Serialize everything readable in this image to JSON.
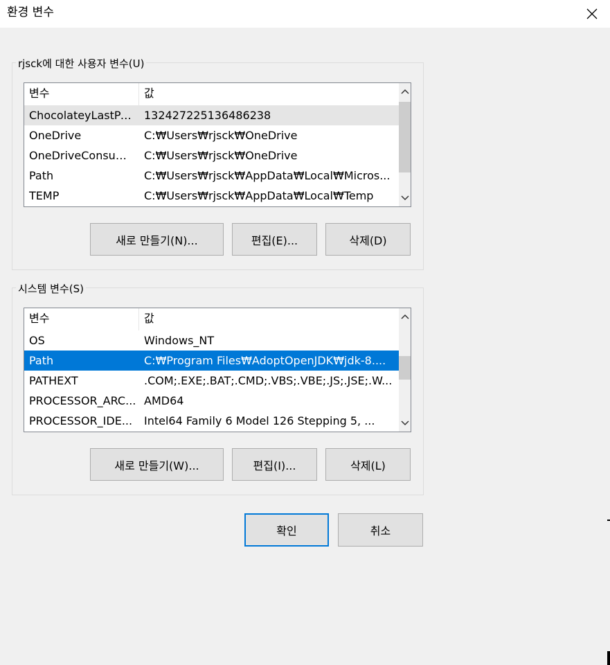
{
  "window": {
    "title": "환경 변수",
    "close_icon": "close-icon"
  },
  "user_vars": {
    "group_label": "rjsck에 대한 사용자 변수(U)",
    "columns": [
      "변수",
      "값"
    ],
    "rows": [
      {
        "name": "ChocolateyLastPa...",
        "value": "132427225136486238"
      },
      {
        "name": "OneDrive",
        "value": "C:₩Users₩rjsck₩OneDrive"
      },
      {
        "name": "OneDriveConsumer",
        "value": "C:₩Users₩rjsck₩OneDrive"
      },
      {
        "name": "Path",
        "value": "C:₩Users₩rjsck₩AppData₩Local₩Micros..."
      },
      {
        "name": "TEMP",
        "value": "C:₩Users₩rjsck₩AppData₩Local₩Temp"
      }
    ],
    "buttons": {
      "new": "새로 만들기(N)...",
      "edit": "편집(E)...",
      "delete": "삭제(D)"
    }
  },
  "system_vars": {
    "group_label": "시스템 변수(S)",
    "columns": [
      "변수",
      "값"
    ],
    "rows": [
      {
        "name": "OS",
        "value": "Windows_NT"
      },
      {
        "name": "Path",
        "value": "C:₩Program Files₩AdoptOpenJDK₩jdk-8...."
      },
      {
        "name": "PATHEXT",
        "value": ".COM;.EXE;.BAT;.CMD;.VBS;.VBE;.JS;.JSE;.W..."
      },
      {
        "name": "PROCESSOR_ARC...",
        "value": "AMD64"
      },
      {
        "name": "PROCESSOR_IDE...",
        "value": "Intel64 Family 6 Model 126 Stepping 5, ..."
      }
    ],
    "buttons": {
      "new": "새로 만들기(W)...",
      "edit": "편집(I)...",
      "delete": "삭제(L)"
    }
  },
  "dialog_buttons": {
    "ok": "확인",
    "cancel": "취소"
  },
  "colors": {
    "selection": "#0078d7",
    "background": "#f0f0f0"
  }
}
